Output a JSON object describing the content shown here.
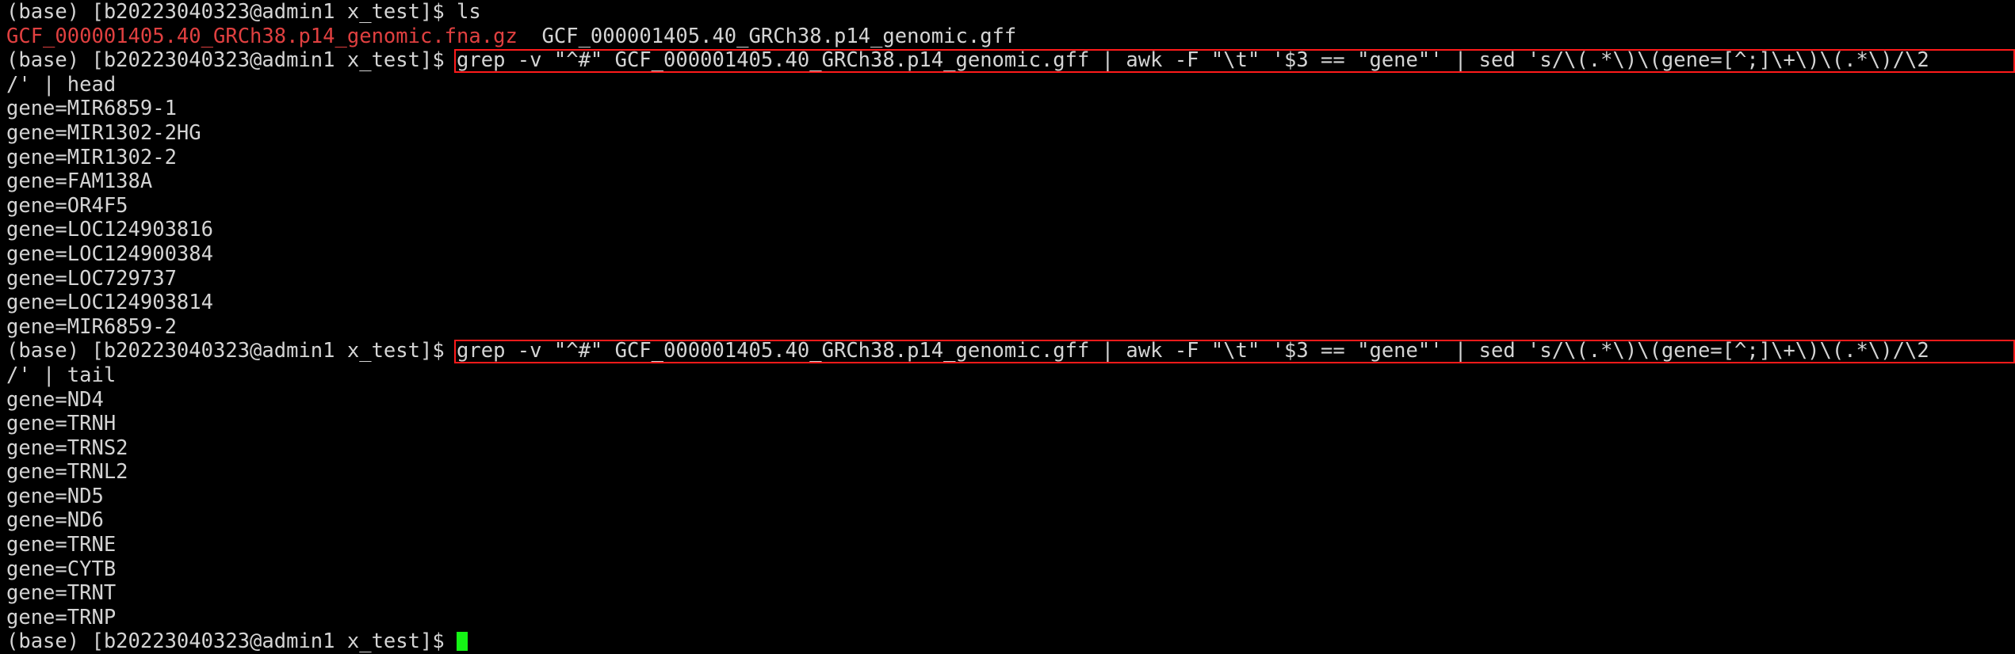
{
  "terminal": {
    "colors": {
      "background": "#000000",
      "foreground": "#d4d4d4",
      "archive_file": "#e04040",
      "command_box_border": "#ff1a1a",
      "cursor": "#15f415"
    },
    "prompt": "(base) [b20223040323@admin1 x_test]$ ",
    "lines": [
      {
        "id": "ls-command",
        "type": "prompt",
        "prompt": "(base) [b20223040323@admin1 x_test]$ ",
        "command": "ls"
      },
      {
        "id": "ls-output",
        "type": "output-files",
        "file_archive": "GCF_000001405.40_GRCh38.p14_genomic.fna.gz",
        "gap": "  ",
        "file_plain": "GCF_000001405.40_GRCh38.p14_genomic.gff"
      },
      {
        "id": "grep-head-command",
        "type": "prompt-boxed",
        "prompt": "(base) [b20223040323@admin1 x_test]$ ",
        "command": "grep -v \"^#\" GCF_000001405.40_GRCh38.p14_genomic.gff | awk -F \"\\t\" '$3 == \"gene\"' | sed 's/\\(.*\\)\\(gene=[^;]\\+\\)\\(.*\\)/\\2"
      },
      {
        "id": "grep-head-wrap",
        "type": "output",
        "text": "/' | head"
      },
      {
        "id": "head-1",
        "type": "output",
        "text": "gene=MIR6859-1"
      },
      {
        "id": "head-2",
        "type": "output",
        "text": "gene=MIR1302-2HG"
      },
      {
        "id": "head-3",
        "type": "output",
        "text": "gene=MIR1302-2"
      },
      {
        "id": "head-4",
        "type": "output",
        "text": "gene=FAM138A"
      },
      {
        "id": "head-5",
        "type": "output",
        "text": "gene=OR4F5"
      },
      {
        "id": "head-6",
        "type": "output",
        "text": "gene=LOC124903816"
      },
      {
        "id": "head-7",
        "type": "output",
        "text": "gene=LOC124900384"
      },
      {
        "id": "head-8",
        "type": "output",
        "text": "gene=LOC729737"
      },
      {
        "id": "head-9",
        "type": "output",
        "text": "gene=LOC124903814"
      },
      {
        "id": "head-10",
        "type": "output",
        "text": "gene=MIR6859-2"
      },
      {
        "id": "grep-tail-command",
        "type": "prompt-boxed",
        "prompt": "(base) [b20223040323@admin1 x_test]$ ",
        "command": "grep -v \"^#\" GCF_000001405.40_GRCh38.p14_genomic.gff | awk -F \"\\t\" '$3 == \"gene\"' | sed 's/\\(.*\\)\\(gene=[^;]\\+\\)\\(.*\\)/\\2"
      },
      {
        "id": "grep-tail-wrap",
        "type": "output",
        "text": "/' | tail"
      },
      {
        "id": "tail-1",
        "type": "output",
        "text": "gene=ND4"
      },
      {
        "id": "tail-2",
        "type": "output",
        "text": "gene=TRNH"
      },
      {
        "id": "tail-3",
        "type": "output",
        "text": "gene=TRNS2"
      },
      {
        "id": "tail-4",
        "type": "output",
        "text": "gene=TRNL2"
      },
      {
        "id": "tail-5",
        "type": "output",
        "text": "gene=ND5"
      },
      {
        "id": "tail-6",
        "type": "output",
        "text": "gene=ND6"
      },
      {
        "id": "tail-7",
        "type": "output",
        "text": "gene=TRNE"
      },
      {
        "id": "tail-8",
        "type": "output",
        "text": "gene=CYTB"
      },
      {
        "id": "tail-9",
        "type": "output",
        "text": "gene=TRNT"
      },
      {
        "id": "tail-10",
        "type": "output",
        "text": "gene=TRNP"
      },
      {
        "id": "final-prompt",
        "type": "prompt-cursor",
        "prompt": "(base) [b20223040323@admin1 x_test]$ ",
        "command": ""
      }
    ]
  }
}
